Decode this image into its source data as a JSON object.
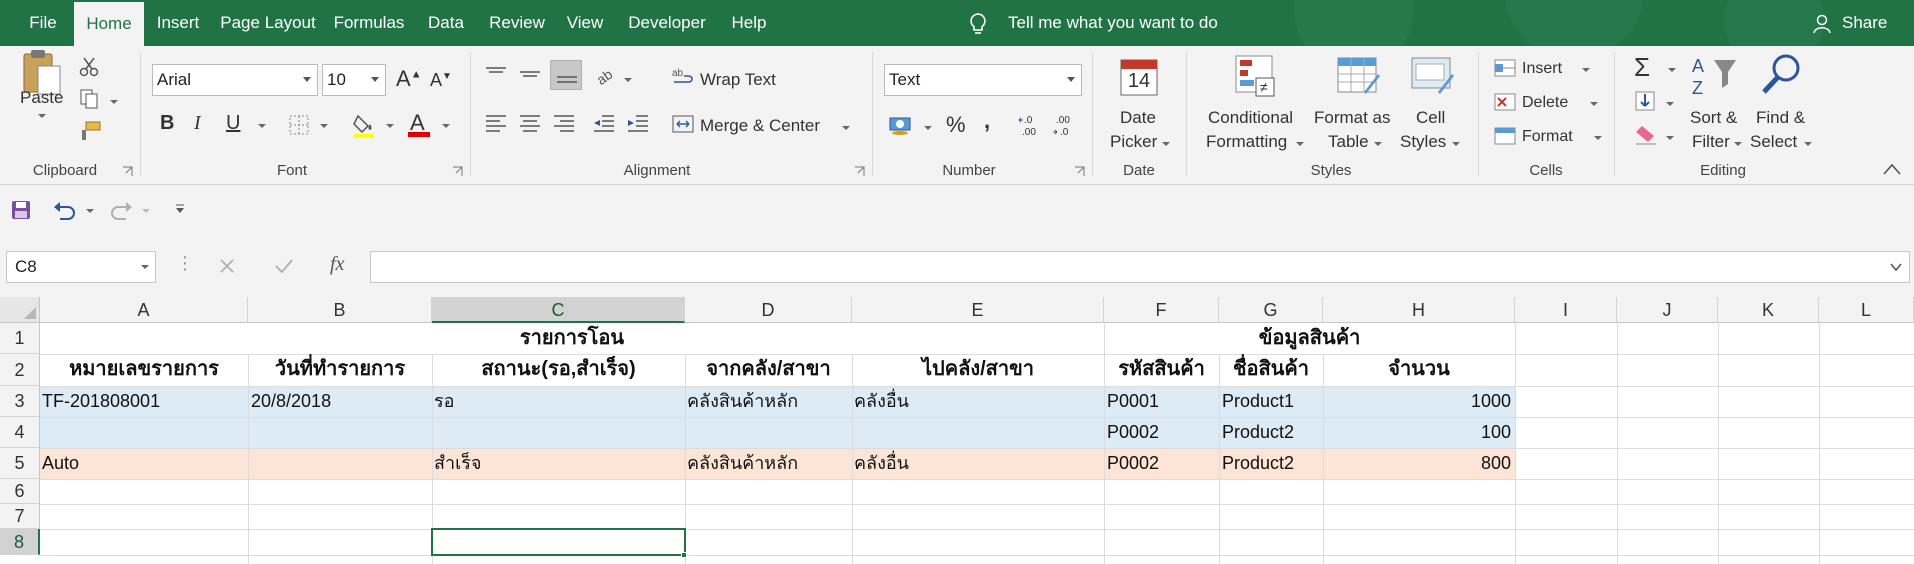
{
  "menu": {
    "file": "File",
    "tabs": [
      "Home",
      "Insert",
      "Page Layout",
      "Formulas",
      "Data",
      "Review",
      "View",
      "Developer",
      "Help"
    ],
    "tell_me": "Tell me what you want to do",
    "share": "Share"
  },
  "ribbon": {
    "clipboard": {
      "paste": "Paste",
      "label": "Clipboard"
    },
    "font": {
      "name": "Arial",
      "size": "10",
      "bold": "B",
      "italic": "I",
      "underline": "U",
      "label": "Font"
    },
    "alignment": {
      "wrap_text": "Wrap Text",
      "merge_center": "Merge & Center",
      "label": "Alignment"
    },
    "number": {
      "format": "Text",
      "percent": "%",
      "comma": ",",
      "label": "Number"
    },
    "date": {
      "line1": "Date",
      "line2": "Picker",
      "label": "Date",
      "day": "14"
    },
    "styles": {
      "conditional_1": "Conditional",
      "conditional_2": "Formatting",
      "table_1": "Format as",
      "table_2": "Table",
      "cell_1": "Cell",
      "cell_2": "Styles",
      "label": "Styles"
    },
    "cells": {
      "insert": "Insert",
      "delete": "Delete",
      "format": "Format",
      "label": "Cells"
    },
    "editing": {
      "sort_1": "Sort &",
      "sort_2": "Filter",
      "find_1": "Find &",
      "find_2": "Select",
      "label": "Editing"
    }
  },
  "formula_bar": {
    "name_box": "C8",
    "fx": "fx",
    "value": ""
  },
  "columns": [
    "A",
    "B",
    "C",
    "D",
    "E",
    "F",
    "G",
    "H",
    "I",
    "J",
    "K",
    "L"
  ],
  "rows": [
    "1",
    "2",
    "3",
    "4",
    "5",
    "6",
    "7",
    "8"
  ],
  "sheet": {
    "r1": {
      "transfer_header": "รายการโอน",
      "product_header": "ข้อมูลสินค้า"
    },
    "r2": {
      "a": "หมายเลขรายการ",
      "b": "วันที่ทำรายการ",
      "c": "สถานะ(รอ,สำเร็จ)",
      "d": "จากคลัง/สาขา",
      "e": "ไปคลัง/สาขา",
      "f": "รหัสสินค้า",
      "g": "ชื่อสินค้า",
      "h": "จำนวน"
    },
    "r3": {
      "a": "TF-201808001",
      "b": "20/8/2018",
      "c": "รอ",
      "d": "คลังสินค้าหลัก",
      "e": "คลังอื่น",
      "f": "P0001",
      "g": "Product1",
      "h": "1000"
    },
    "r4": {
      "f": "P0002",
      "g": "Product2",
      "h": "100"
    },
    "r5": {
      "a": "Auto",
      "c": "สำเร็จ",
      "d": "คลังสินค้าหลัก",
      "e": "คลังอื่น",
      "f": "P0002",
      "g": "Product2",
      "h": "800"
    }
  },
  "colors": {
    "accent": "#217346",
    "band_blue": "#ddebf7",
    "band_orange": "#fce4d6"
  }
}
